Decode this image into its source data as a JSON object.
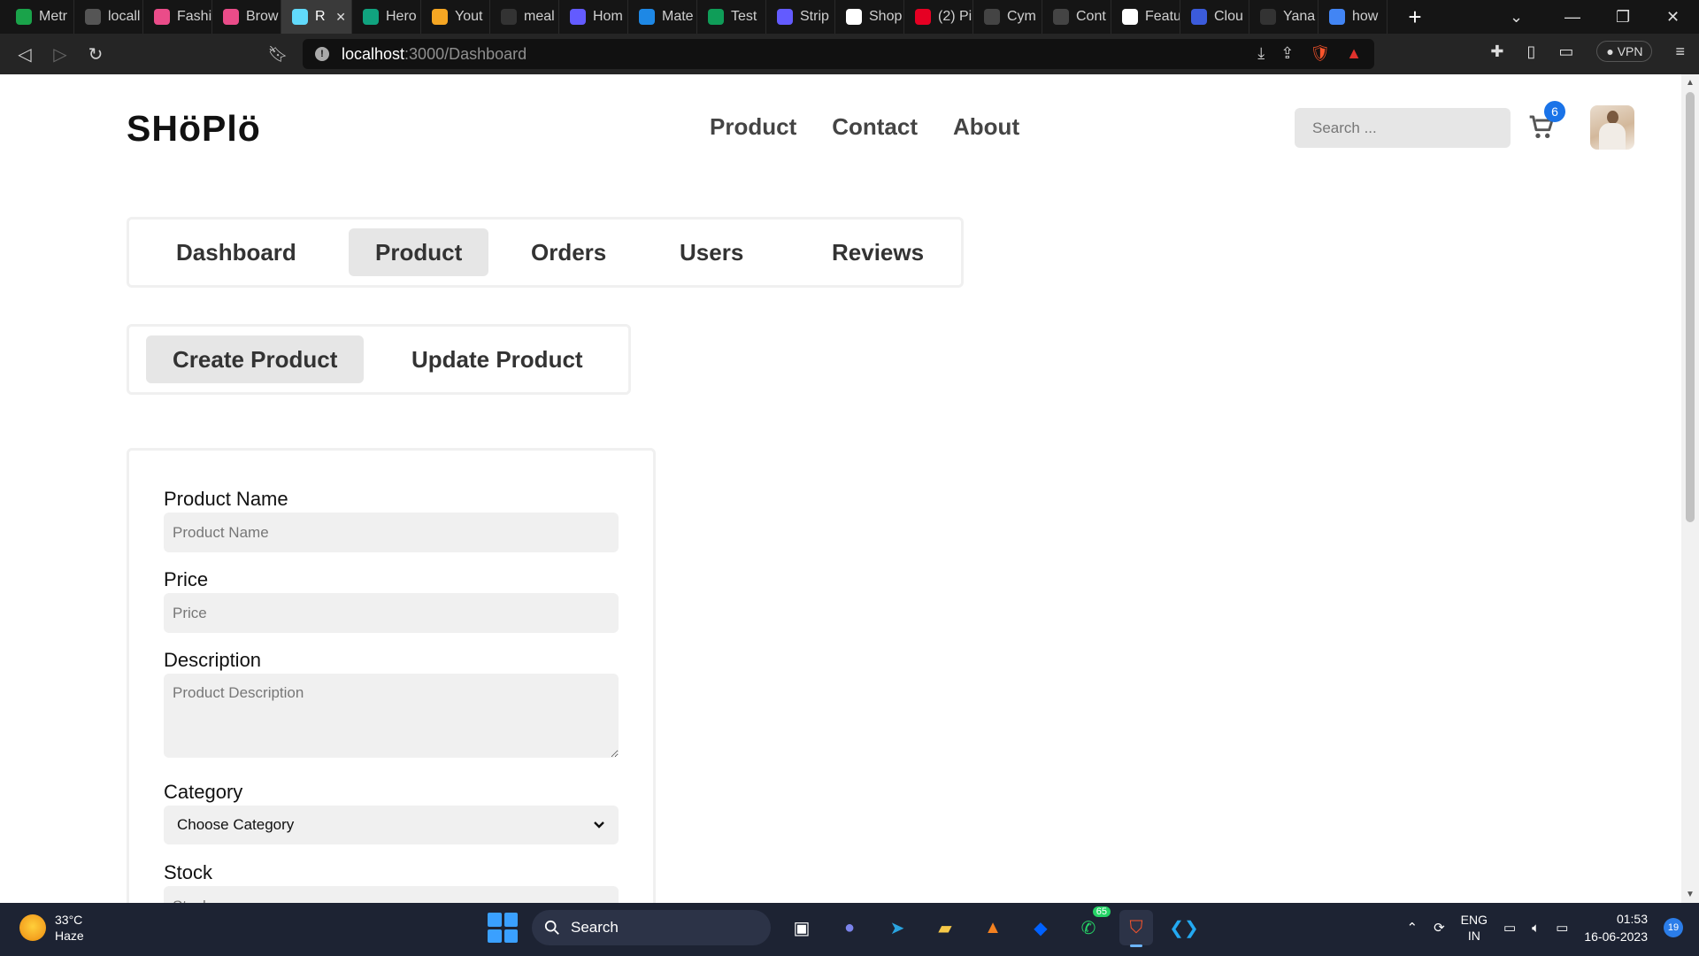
{
  "browser": {
    "tabs": [
      {
        "label": "Metr",
        "fav_color": "#1aa34a"
      },
      {
        "label": "locall",
        "fav_color": "#555555"
      },
      {
        "label": "Fashi",
        "fav_color": "#ea4c89"
      },
      {
        "label": "Brow",
        "fav_color": "#ea4c89"
      },
      {
        "label": "R",
        "fav_color": "#61dafb",
        "active": true
      },
      {
        "label": "Hero",
        "fav_color": "#10a37f"
      },
      {
        "label": "Yout",
        "fav_color": "#f5a623"
      },
      {
        "label": "meal",
        "fav_color": "#333333"
      },
      {
        "label": "Hom",
        "fav_color": "#635bff"
      },
      {
        "label": "Mate",
        "fav_color": "#1e88e5"
      },
      {
        "label": "Test",
        "fav_color": "#0f9d58"
      },
      {
        "label": "Strip",
        "fav_color": "#635bff"
      },
      {
        "label": "Shop",
        "fav_color": "#ffffff"
      },
      {
        "label": "(2) Pi",
        "fav_color": "#e60023"
      },
      {
        "label": "Cym",
        "fav_color": "#444444"
      },
      {
        "label": "Cont",
        "fav_color": "#444444"
      },
      {
        "label": "Featu",
        "fav_color": "#ffffff"
      },
      {
        "label": "Clou",
        "fav_color": "#3b5bdb"
      },
      {
        "label": "Yana",
        "fav_color": "#333333"
      },
      {
        "label": "how",
        "fav_color": "#4285f4"
      }
    ],
    "url_host": "localhost",
    "url_path": ":3000/Dashboard",
    "vpn_label": "VPN"
  },
  "site": {
    "logo": "SHöPlö",
    "nav": [
      "Product",
      "Contact",
      "About"
    ],
    "search_placeholder": "Search ...",
    "cart_count": "6"
  },
  "dashboard_tabs": {
    "items": [
      "Dashboard",
      "Product",
      "Orders",
      "Users",
      "Reviews"
    ],
    "selected": "Product"
  },
  "product_tabs": {
    "items": [
      "Create Product",
      "Update Product"
    ],
    "selected": "Create Product"
  },
  "form": {
    "name_label": "Product Name",
    "name_placeholder": "Product Name",
    "price_label": "Price",
    "price_placeholder": "Price",
    "description_label": "Description",
    "description_placeholder": "Product Description",
    "category_label": "Category",
    "category_value": "Choose Category",
    "stock_label": "Stock",
    "stock_placeholder": "Stock"
  },
  "taskbar": {
    "temperature": "33°C",
    "weather": "Haze",
    "search_label": "Search",
    "whatsapp_badge": "65",
    "lang_line1": "ENG",
    "lang_line2": "IN",
    "time": "01:53",
    "date": "16-06-2023",
    "notification_count": "19"
  }
}
